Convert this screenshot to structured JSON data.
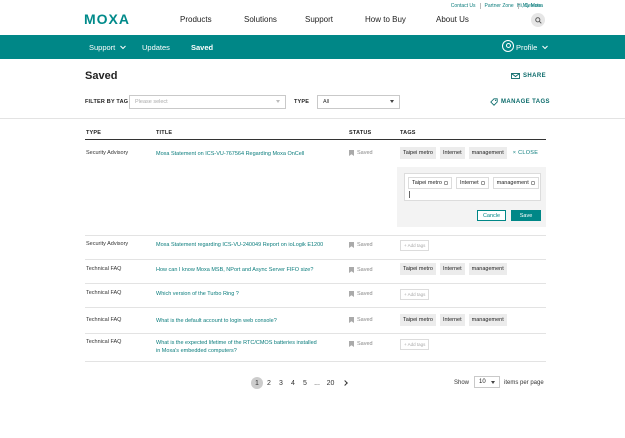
{
  "utility_links": [
    "Contact Us",
    "Partner Zone",
    "My Moxa"
  ],
  "user_greeting": "Hi, Celeste",
  "brand": "MOXA",
  "main_nav": [
    "Products",
    "Solutions",
    "Support",
    "How to Buy",
    "About Us"
  ],
  "sub_nav": {
    "support": "Support",
    "updates": "Updates",
    "saved": "Saved",
    "profile": "Profile"
  },
  "page": {
    "title": "Saved",
    "share": "SHARE",
    "manage_tags": "MANAGE TAGS"
  },
  "filters": {
    "tag_label": "FILTER BY TAG",
    "tag_placeholder": "Please select",
    "type_label": "TYPE",
    "type_value": "All"
  },
  "table": {
    "headers": {
      "type": "TYPE",
      "title": "TITLE",
      "status": "STATUS",
      "tags": "TAGS"
    },
    "status_label": "Saved",
    "add_tags_label": "+ Add tags",
    "close_label": "× CLOSE",
    "rows": [
      {
        "type": "Security Advisory",
        "title": "Moxa Statement on ICS-VU-767564 Regarding Moxa OnCell",
        "tags": [
          "Taipei metro",
          "Internet",
          "management"
        ]
      },
      {
        "type": "Security Advisory",
        "title": "Moxa Statement regarding ICS-VU-240049 Report on ioLogik E1200",
        "tags": []
      },
      {
        "type": "Technical FAQ",
        "title": "How can I know Moxa MSB, NPort and Async Server FIFO size?",
        "tags": [
          "Taipei metro",
          "Internet",
          "management"
        ]
      },
      {
        "type": "Technical FAQ",
        "title": "Which version of the Turbo Ring ?",
        "tags": []
      },
      {
        "type": "Technical FAQ",
        "title": "What is the default account to login web console?",
        "tags": [
          "Taipei metro",
          "Internet",
          "management"
        ]
      },
      {
        "type": "Technical FAQ",
        "title_line1": "What is the expected lifetime of the RTC/CMOS batteries installed",
        "title_line2": "in Moxa's embedded computers?",
        "tags": []
      }
    ]
  },
  "editor": {
    "tags": [
      "Taipei metro",
      "Internet",
      "management"
    ],
    "cancel": "Cancle",
    "save": "Save"
  },
  "pagination": {
    "pages": [
      "1",
      "2",
      "3",
      "4",
      "5",
      "...",
      "20"
    ],
    "show_label": "Show",
    "page_size": "10",
    "per_page_label": "items per page"
  },
  "colors": {
    "teal": "#008787",
    "link": "#0a7c7c"
  }
}
